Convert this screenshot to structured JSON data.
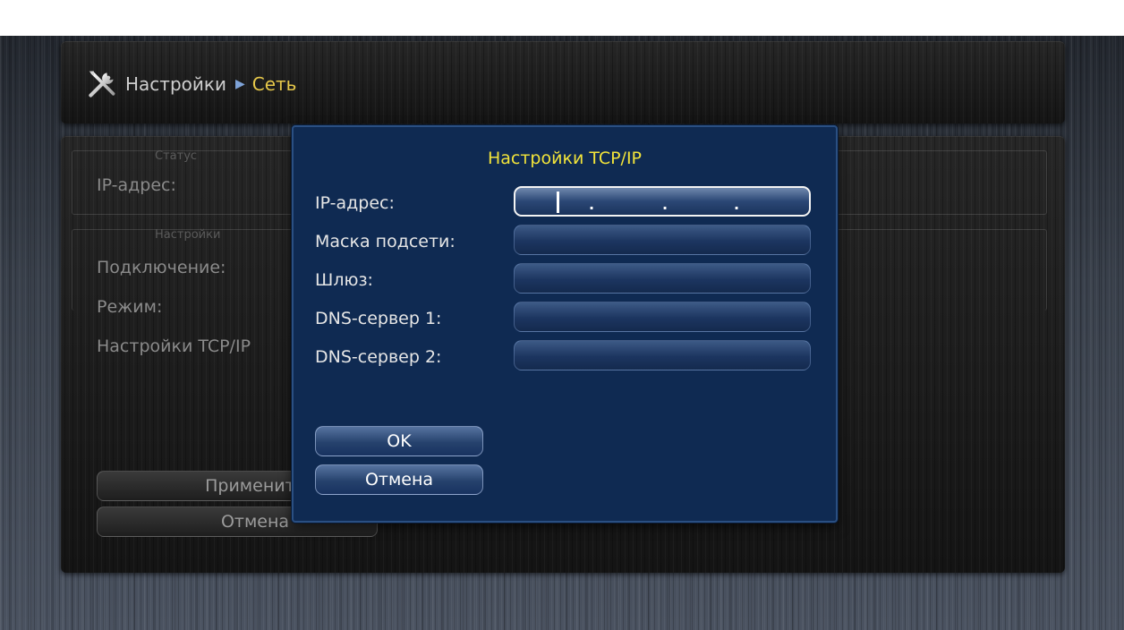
{
  "breadcrumb": {
    "icon": "tools-icon",
    "root": "Настройки",
    "separator": "▶",
    "current": "Сеть"
  },
  "background": {
    "status_group": {
      "title": "Статус",
      "ip_label": "IP-адрес:"
    },
    "settings_group": {
      "title": "Настройки",
      "connection_label": "Подключение:",
      "mode_label": "Режим:",
      "tcpip_label": "Настройки TCP/IP"
    },
    "apply_button": "Применить",
    "cancel_button": "Отмена"
  },
  "dialog": {
    "title": "Настройки TCP/IP",
    "fields": [
      {
        "label": "IP-адрес:",
        "value": ". . .",
        "focused": true
      },
      {
        "label": "Маска подсети:",
        "value": ""
      },
      {
        "label": "Шлюз:",
        "value": ""
      },
      {
        "label": "DNS-сервер 1:",
        "value": ""
      },
      {
        "label": "DNS-сервер 2:",
        "value": ""
      }
    ],
    "ok_button": "OK",
    "cancel_button": "Отмена"
  },
  "colors": {
    "accent": "#e6c84a",
    "dialog_title": "#f2e43a",
    "dialog_bg": "#0f2a52",
    "focus_border": "#f4f4f4"
  }
}
